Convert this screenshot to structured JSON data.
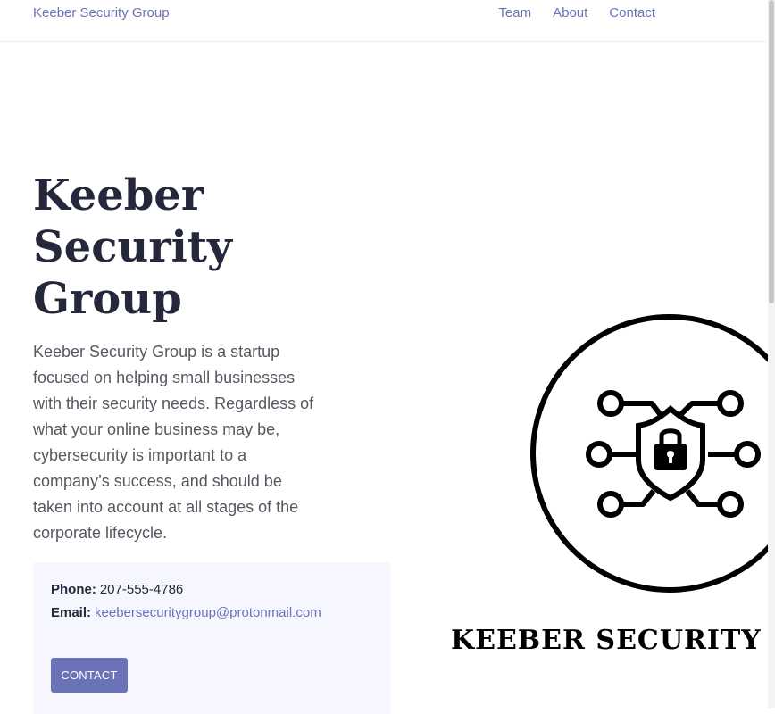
{
  "nav": {
    "brand": "Keeber Security Group",
    "links": [
      "Team",
      "About",
      "Contact"
    ]
  },
  "hero": {
    "title_lines": [
      "Keeber",
      "Security",
      "Group"
    ],
    "description": "Keeber Security Group is a startup focused on helping small businesses with their security needs. Regardless of what your online business may be, cybersecurity is important to a company’s success, and should be taken into account at all stages of the corporate lifecycle."
  },
  "contact": {
    "phone_label": "Phone:",
    "phone": "207-555-4786",
    "email_label": "Email:",
    "email": "keebersecuritygroup@protonmail.com",
    "button_label": "CONTACT"
  },
  "logo": {
    "text": "KEEBER SECURITY",
    "icon": "shield-lock-circuit-icon"
  },
  "colors": {
    "accent": "#6a73b8",
    "heading": "#25283a",
    "body_text": "#555860",
    "card_bg": "#f6f7fe"
  }
}
